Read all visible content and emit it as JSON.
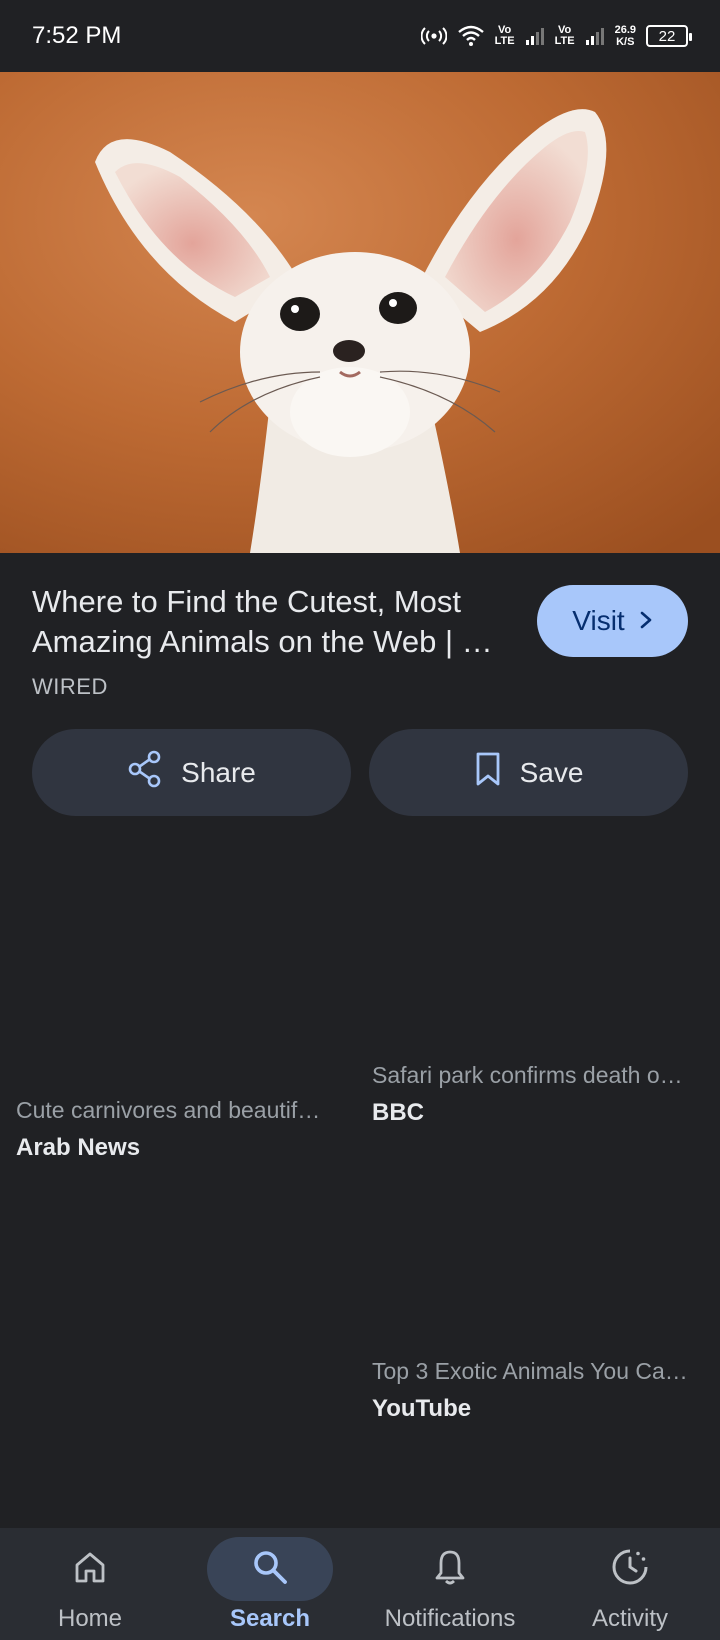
{
  "status_bar": {
    "time": "7:52 PM",
    "network_1": "Vo\nLTE",
    "network_2": "Vo\nLTE",
    "speed_value": "26.9",
    "speed_unit": "K/S",
    "battery": "22"
  },
  "hero": {
    "image_icon": "fennec-fox-photo"
  },
  "result": {
    "title": "Where to Find the Cutest, Most Amazing Animals on the Web | …",
    "source": "WIRED",
    "visit_label": "Visit"
  },
  "actions": {
    "share_label": "Share",
    "save_label": "Save"
  },
  "related": [
    {
      "snippet": "Cute carnivores and beautif…",
      "source": "Arab News"
    },
    {
      "snippet": "Safari park confirms death o…",
      "source": "BBC"
    },
    {
      "snippet": "Top 3 Exotic Animals You Ca…",
      "source": "YouTube"
    }
  ],
  "bottom_nav": {
    "items": [
      {
        "label": "Home",
        "icon": "home-icon"
      },
      {
        "label": "Search",
        "icon": "search-icon",
        "active": true
      },
      {
        "label": "Notifications",
        "icon": "bell-icon"
      },
      {
        "label": "Activity",
        "icon": "activity-icon"
      }
    ]
  },
  "colors": {
    "background": "#202124",
    "accent": "#a8c7fa",
    "button_bg": "#303540",
    "nav_bg": "#2a2d33"
  }
}
